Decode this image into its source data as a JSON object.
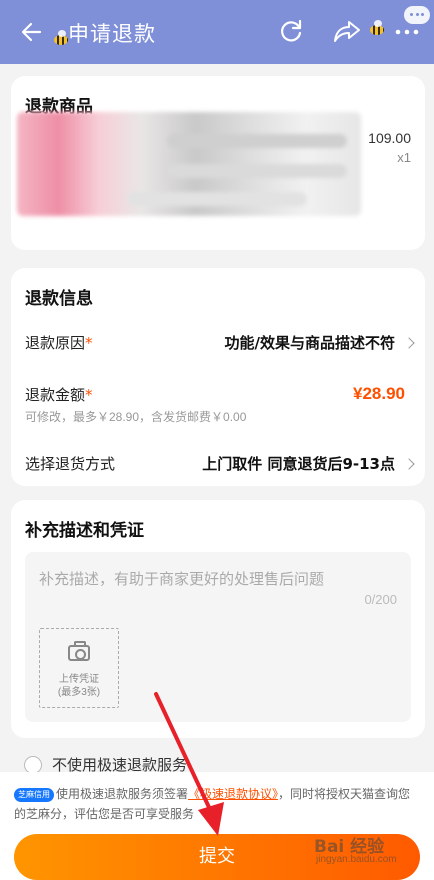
{
  "header": {
    "title": "申请退款",
    "back_icon": "back-arrow-icon",
    "refresh_icon": "refresh-icon",
    "share_icon": "share-icon",
    "more_icon": "more-icon"
  },
  "product_card": {
    "title": "退款商品",
    "price": "109.00",
    "quantity": "x1"
  },
  "refund_info": {
    "title": "退款信息",
    "reason_label": "退款原因",
    "reason_value": "功能/效果与商品描述不符",
    "amount_label": "退款金额",
    "amount_value": "¥28.90",
    "amount_note": "可修改，最多￥28.90，含发货邮费￥0.00",
    "return_label": "选择退货方式",
    "return_value": "上门取件 同意退货后9-13点",
    "required_mark": "*"
  },
  "evidence": {
    "title": "补充描述和凭证",
    "placeholder": "补充描述，有助于商家更好的处理售后问题",
    "counter": "0/200",
    "upload_label_1": "上传凭证",
    "upload_label_2": "(最多3张)"
  },
  "fast_refund": {
    "option_label": "不使用极速退款服务"
  },
  "agreement": {
    "badge": "芝麻信用",
    "text_1": "使用极速退款服务须签署",
    "link": "《极速退款协议》",
    "text_2": "，同时将授权天猫查询您的芝麻分，评估您是否可享受服务"
  },
  "submit": {
    "label": "提交"
  },
  "watermark": {
    "brand": "Bai 经验",
    "url": "jingyan.baidu.com"
  },
  "colors": {
    "header_bg": "#7f90d8",
    "accent": "#ff5000",
    "submit_gradient_start": "#ff9500",
    "submit_gradient_end": "#ff5a00"
  }
}
